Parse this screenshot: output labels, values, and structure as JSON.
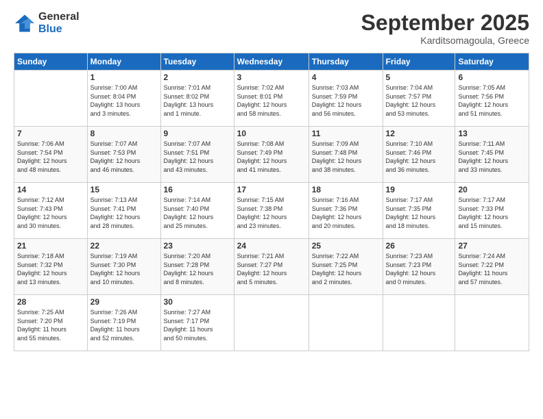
{
  "logo": {
    "general": "General",
    "blue": "Blue"
  },
  "header": {
    "month": "September 2025",
    "location": "Karditsomagoula, Greece"
  },
  "days": [
    "Sunday",
    "Monday",
    "Tuesday",
    "Wednesday",
    "Thursday",
    "Friday",
    "Saturday"
  ],
  "weeks": [
    [
      {
        "day": "",
        "info": ""
      },
      {
        "day": "1",
        "info": "Sunrise: 7:00 AM\nSunset: 8:04 PM\nDaylight: 13 hours\nand 3 minutes."
      },
      {
        "day": "2",
        "info": "Sunrise: 7:01 AM\nSunset: 8:02 PM\nDaylight: 13 hours\nand 1 minute."
      },
      {
        "day": "3",
        "info": "Sunrise: 7:02 AM\nSunset: 8:01 PM\nDaylight: 12 hours\nand 58 minutes."
      },
      {
        "day": "4",
        "info": "Sunrise: 7:03 AM\nSunset: 7:59 PM\nDaylight: 12 hours\nand 56 minutes."
      },
      {
        "day": "5",
        "info": "Sunrise: 7:04 AM\nSunset: 7:57 PM\nDaylight: 12 hours\nand 53 minutes."
      },
      {
        "day": "6",
        "info": "Sunrise: 7:05 AM\nSunset: 7:56 PM\nDaylight: 12 hours\nand 51 minutes."
      }
    ],
    [
      {
        "day": "7",
        "info": "Sunrise: 7:06 AM\nSunset: 7:54 PM\nDaylight: 12 hours\nand 48 minutes."
      },
      {
        "day": "8",
        "info": "Sunrise: 7:07 AM\nSunset: 7:53 PM\nDaylight: 12 hours\nand 46 minutes."
      },
      {
        "day": "9",
        "info": "Sunrise: 7:07 AM\nSunset: 7:51 PM\nDaylight: 12 hours\nand 43 minutes."
      },
      {
        "day": "10",
        "info": "Sunrise: 7:08 AM\nSunset: 7:49 PM\nDaylight: 12 hours\nand 41 minutes."
      },
      {
        "day": "11",
        "info": "Sunrise: 7:09 AM\nSunset: 7:48 PM\nDaylight: 12 hours\nand 38 minutes."
      },
      {
        "day": "12",
        "info": "Sunrise: 7:10 AM\nSunset: 7:46 PM\nDaylight: 12 hours\nand 36 minutes."
      },
      {
        "day": "13",
        "info": "Sunrise: 7:11 AM\nSunset: 7:45 PM\nDaylight: 12 hours\nand 33 minutes."
      }
    ],
    [
      {
        "day": "14",
        "info": "Sunrise: 7:12 AM\nSunset: 7:43 PM\nDaylight: 12 hours\nand 30 minutes."
      },
      {
        "day": "15",
        "info": "Sunrise: 7:13 AM\nSunset: 7:41 PM\nDaylight: 12 hours\nand 28 minutes."
      },
      {
        "day": "16",
        "info": "Sunrise: 7:14 AM\nSunset: 7:40 PM\nDaylight: 12 hours\nand 25 minutes."
      },
      {
        "day": "17",
        "info": "Sunrise: 7:15 AM\nSunset: 7:38 PM\nDaylight: 12 hours\nand 23 minutes."
      },
      {
        "day": "18",
        "info": "Sunrise: 7:16 AM\nSunset: 7:36 PM\nDaylight: 12 hours\nand 20 minutes."
      },
      {
        "day": "19",
        "info": "Sunrise: 7:17 AM\nSunset: 7:35 PM\nDaylight: 12 hours\nand 18 minutes."
      },
      {
        "day": "20",
        "info": "Sunrise: 7:17 AM\nSunset: 7:33 PM\nDaylight: 12 hours\nand 15 minutes."
      }
    ],
    [
      {
        "day": "21",
        "info": "Sunrise: 7:18 AM\nSunset: 7:32 PM\nDaylight: 12 hours\nand 13 minutes."
      },
      {
        "day": "22",
        "info": "Sunrise: 7:19 AM\nSunset: 7:30 PM\nDaylight: 12 hours\nand 10 minutes."
      },
      {
        "day": "23",
        "info": "Sunrise: 7:20 AM\nSunset: 7:28 PM\nDaylight: 12 hours\nand 8 minutes."
      },
      {
        "day": "24",
        "info": "Sunrise: 7:21 AM\nSunset: 7:27 PM\nDaylight: 12 hours\nand 5 minutes."
      },
      {
        "day": "25",
        "info": "Sunrise: 7:22 AM\nSunset: 7:25 PM\nDaylight: 12 hours\nand 2 minutes."
      },
      {
        "day": "26",
        "info": "Sunrise: 7:23 AM\nSunset: 7:23 PM\nDaylight: 12 hours\nand 0 minutes."
      },
      {
        "day": "27",
        "info": "Sunrise: 7:24 AM\nSunset: 7:22 PM\nDaylight: 11 hours\nand 57 minutes."
      }
    ],
    [
      {
        "day": "28",
        "info": "Sunrise: 7:25 AM\nSunset: 7:20 PM\nDaylight: 11 hours\nand 55 minutes."
      },
      {
        "day": "29",
        "info": "Sunrise: 7:26 AM\nSunset: 7:19 PM\nDaylight: 11 hours\nand 52 minutes."
      },
      {
        "day": "30",
        "info": "Sunrise: 7:27 AM\nSunset: 7:17 PM\nDaylight: 11 hours\nand 50 minutes."
      },
      {
        "day": "",
        "info": ""
      },
      {
        "day": "",
        "info": ""
      },
      {
        "day": "",
        "info": ""
      },
      {
        "day": "",
        "info": ""
      }
    ]
  ]
}
